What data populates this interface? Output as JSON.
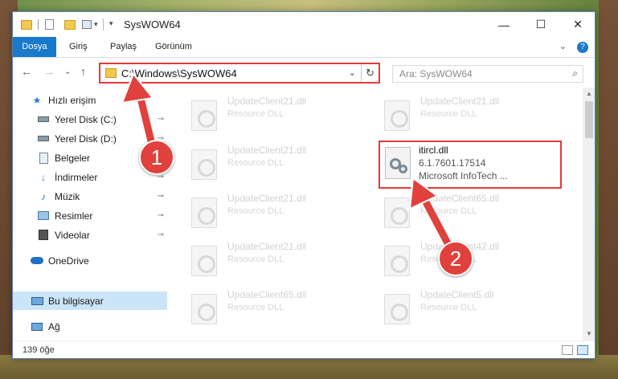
{
  "window": {
    "title": "SysWOW64",
    "controls": {
      "minimize": "—",
      "maximize": "☐",
      "close": "✕"
    }
  },
  "ribbon": {
    "tabs": [
      {
        "label": "Dosya",
        "active": true
      },
      {
        "label": "Giriş"
      },
      {
        "label": "Paylaş"
      },
      {
        "label": "Görünüm"
      }
    ],
    "expand_glyph": "⌄",
    "help_glyph": "?"
  },
  "address_bar": {
    "path": "C:\\Windows\\SysWOW64",
    "refresh_glyph": "↻",
    "dropdown_glyph": "⌄"
  },
  "search": {
    "placeholder": "Ara: SysWOW64",
    "icon": "search-icon"
  },
  "nav_buttons": {
    "back": "←",
    "forward": "→",
    "recent": "⌄",
    "up": "↑"
  },
  "sidebar": {
    "items": [
      {
        "label": "Hızlı erişim",
        "icon": "star-icon",
        "pinned": false
      },
      {
        "label": "Yerel Disk (C:)",
        "icon": "drive-icon",
        "pinned": true
      },
      {
        "label": "Yerel Disk (D:)",
        "icon": "drive-icon",
        "pinned": true
      },
      {
        "label": "Belgeler",
        "icon": "documents-icon",
        "pinned": true
      },
      {
        "label": "İndirmeler",
        "icon": "download-icon",
        "pinned": true
      },
      {
        "label": "Müzik",
        "icon": "music-icon",
        "pinned": true
      },
      {
        "label": "Resimler",
        "icon": "pictures-icon",
        "pinned": true
      },
      {
        "label": "Videolar",
        "icon": "video-icon",
        "pinned": true
      },
      {
        "label": "OneDrive",
        "icon": "cloud-icon",
        "pinned": false
      },
      {
        "label": "Bu bilgisayar",
        "icon": "computer-icon",
        "pinned": false,
        "selected": true
      },
      {
        "label": "Ağ",
        "icon": "network-icon",
        "pinned": false
      }
    ],
    "pin_glyph": "📌"
  },
  "files": [
    {
      "name": "UpdateClient21.dll",
      "type": "Resource DLL"
    },
    {
      "name": "UpdateClient21.dll",
      "type": "Resource DLL"
    },
    {
      "name": "UpdateClient21.dll",
      "type": "Resource DLL"
    },
    {
      "name": "UpdateClient21.dll",
      "type": "Resource DLL"
    },
    {
      "name": "UpdateClient21.dll",
      "type": "Resource DLL"
    },
    {
      "name": "UpdateClient65.dll",
      "type": "Resource DLL"
    },
    {
      "name": "UpdateClient21.dll",
      "type": "Resource DLL"
    },
    {
      "name": "UpdateClient42.dll",
      "type": "Resource DLL"
    },
    {
      "name": "UpdateClient65.dll",
      "type": "Resource DLL"
    },
    {
      "name": "UpdateClient5.dll",
      "type": "Resource DLL"
    }
  ],
  "highlighted_file": {
    "name": "itircl.dll",
    "version": "6.1.7601.17514",
    "description": "Microsoft InfoTech ..."
  },
  "status_bar": {
    "item_count": "139 öğe"
  },
  "annotations": {
    "step1": "1",
    "step2": "2",
    "color": "#e0413c"
  }
}
